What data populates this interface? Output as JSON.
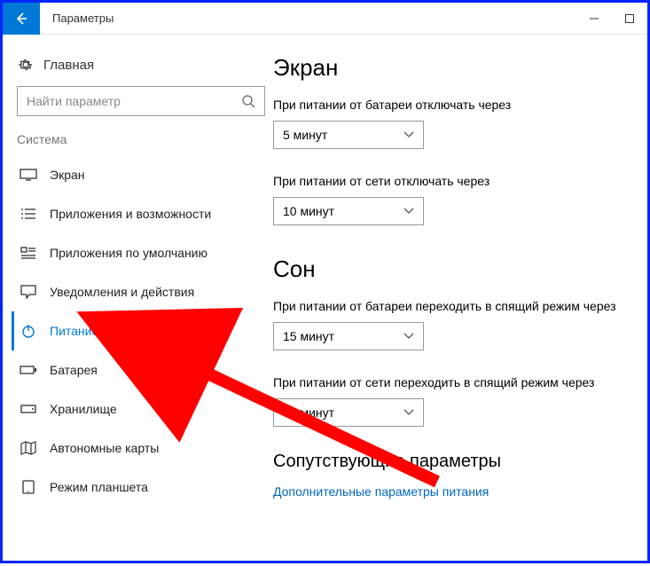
{
  "titlebar": {
    "title": "Параметры"
  },
  "sidebar": {
    "home": "Главная",
    "search_placeholder": "Найти параметр",
    "category": "Система",
    "items": [
      {
        "label": "Экран"
      },
      {
        "label": "Приложения и возможности"
      },
      {
        "label": "Приложения по умолчанию"
      },
      {
        "label": "Уведомления и действия"
      },
      {
        "label": "Питание и спящий режим"
      },
      {
        "label": "Батарея"
      },
      {
        "label": "Хранилище"
      },
      {
        "label": "Автономные карты"
      },
      {
        "label": "Режим планшета"
      }
    ]
  },
  "main": {
    "screen": {
      "heading": "Экран",
      "battery_label": "При питании от батареи отключать через",
      "battery_value": "5 минут",
      "plugged_label": "При питании от сети отключать через",
      "plugged_value": "10 минут"
    },
    "sleep": {
      "heading": "Сон",
      "battery_label": "При питании от батареи переходить в спящий режим через",
      "battery_value": "15 минут",
      "plugged_label": "При питании от сети переходить в спящий режим через",
      "plugged_value": "30 минут"
    },
    "related": {
      "heading": "Сопутствующие параметры",
      "link": "Дополнительные параметры питания"
    }
  }
}
